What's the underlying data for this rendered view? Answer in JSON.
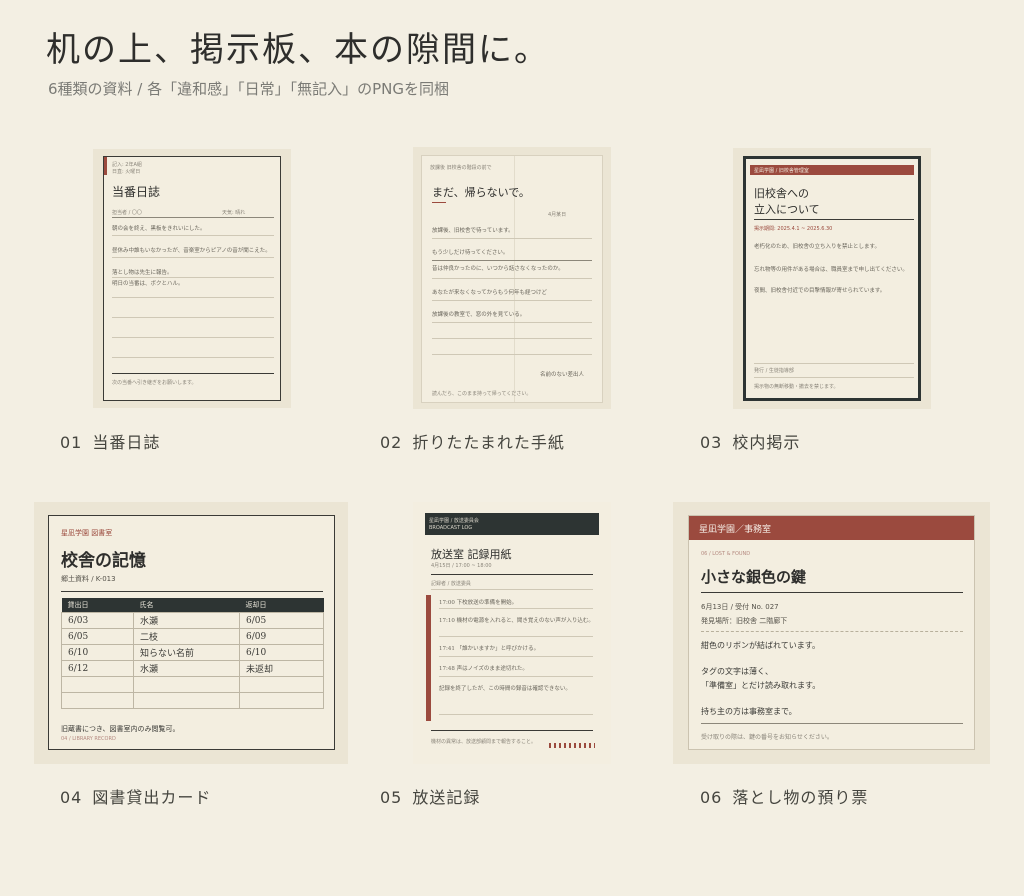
{
  "header": {
    "title": "机の上、掲示板、本の隙間に。",
    "subtitle": "6種類の資料 / 各「違和感」「日常」「無記入」のPNGを同梱"
  },
  "items": [
    {
      "num": "01",
      "label": "当番日誌",
      "doc": {
        "meta1": "記入: 2年A組",
        "meta2": "日直: 火曜日",
        "title": "当番日誌",
        "info_left": "担当者 / 〇〇",
        "info_right": "天気: 晴れ",
        "lines": [
          "朝の会を終え、黒板をきれいにした。",
          "昼休み中誰もいなかったが、音楽室からピアノの音が聞こえた。",
          "落とし物は先生に報告。",
          "明日の当番は、ボクとハル。"
        ],
        "footer": "次の当番へ引き継ぎをお願いします。"
      }
    },
    {
      "num": "02",
      "label": "折りたたまれた手紙",
      "doc": {
        "header": "放課後 旧校舎の階段の前で",
        "title": "まだ、帰らないで。",
        "date": "4月某日",
        "lines": [
          "放課後、旧校舎で待っています。",
          "もう少しだけ待ってください。",
          "昔は仲良かったのに、いつから話さなくなったのか。",
          "あなたが来なくなってからもう何年も経つけど",
          "放課後の教室で、窓の外を見ている。"
        ],
        "sign": "名前のない差出人",
        "footer": "読んだら、このまま持って帰ってください。"
      }
    },
    {
      "num": "03",
      "label": "校内掲示",
      "doc": {
        "band": "星凪学園 / 旧校舎管理室",
        "title1": "旧校舎への",
        "title2": "立入について",
        "notice": "掲示期間: 2025.4.1 ~ 2025.6.30",
        "lines": [
          "老朽化のため、旧校舎の立ち入りを禁止とします。",
          "忘れ物等の用件がある場合は、職員室まで申し出てください。",
          "夜間、旧校舎付近での目撃情報が寄せられています。"
        ],
        "footer1": "発行 / 生徒指導部",
        "footer2": "掲示物の無断移動・撤去を禁じます。"
      }
    },
    {
      "num": "04",
      "label": "図書貸出カード",
      "doc": {
        "org": "星凪学園 図書室",
        "title": "校舎の記憶",
        "code": "郷土資料 / K-013",
        "columns": [
          "貸出日",
          "氏名",
          "返却日"
        ],
        "rows": [
          [
            "6/03",
            "水瀬",
            "6/05"
          ],
          [
            "6/05",
            "二枝",
            "6/09"
          ],
          [
            "6/10",
            "知らない名前",
            "6/10"
          ],
          [
            "6/12",
            "水瀬",
            "未返却"
          ],
          [
            "",
            "",
            ""
          ],
          [
            "",
            "",
            ""
          ]
        ],
        "note": "旧蔵書につき、図書室内のみ閲覧可。",
        "footer": "04 / LIBRARY RECORD"
      }
    },
    {
      "num": "05",
      "label": "放送記録",
      "doc": {
        "band1": "星凪学園 / 放送委員会",
        "band2": "BROADCAST LOG",
        "title": "放送室 記録用紙",
        "sub": "4月15日 / 17:00 ~ 18:00",
        "meta": "記録者 / 放送委員",
        "entries": [
          "17:00 下校放送の準備を開始。",
          "17:10 機材の電源を入れると、聞き覚えのない声が入り込む。",
          "17:41 「誰かいますか」と呼びかける。",
          "17:48 声はノイズのまま途切れた。",
          "記録を終了したが、この時間の録音は確認できない。"
        ],
        "footer": "機材の異常は、放送部顧問まで報告すること。"
      }
    },
    {
      "num": "06",
      "label": "落とし物の預り票",
      "doc": {
        "band": "星凪学園／事務室",
        "tag": "06 / LOST & FOUND",
        "title": "小さな銀色の鍵",
        "date": "6月13日 / 受付 No. 027",
        "place": "発見場所：旧校舎 二階廊下",
        "desc1": "紺色のリボンが結ばれています。",
        "desc2": "タグの文字は薄く、",
        "desc3": "「準備室」とだけ読み取れます。",
        "desc4": "持ち主の方は事務室まで。",
        "footer": "受け取りの際は、鍵の番号をお知らせください。"
      }
    }
  ],
  "colors": {
    "background": "#f3efe3",
    "accent": "#9b4a3e",
    "dark": "#2d3433",
    "paper": "#f3eee0"
  }
}
